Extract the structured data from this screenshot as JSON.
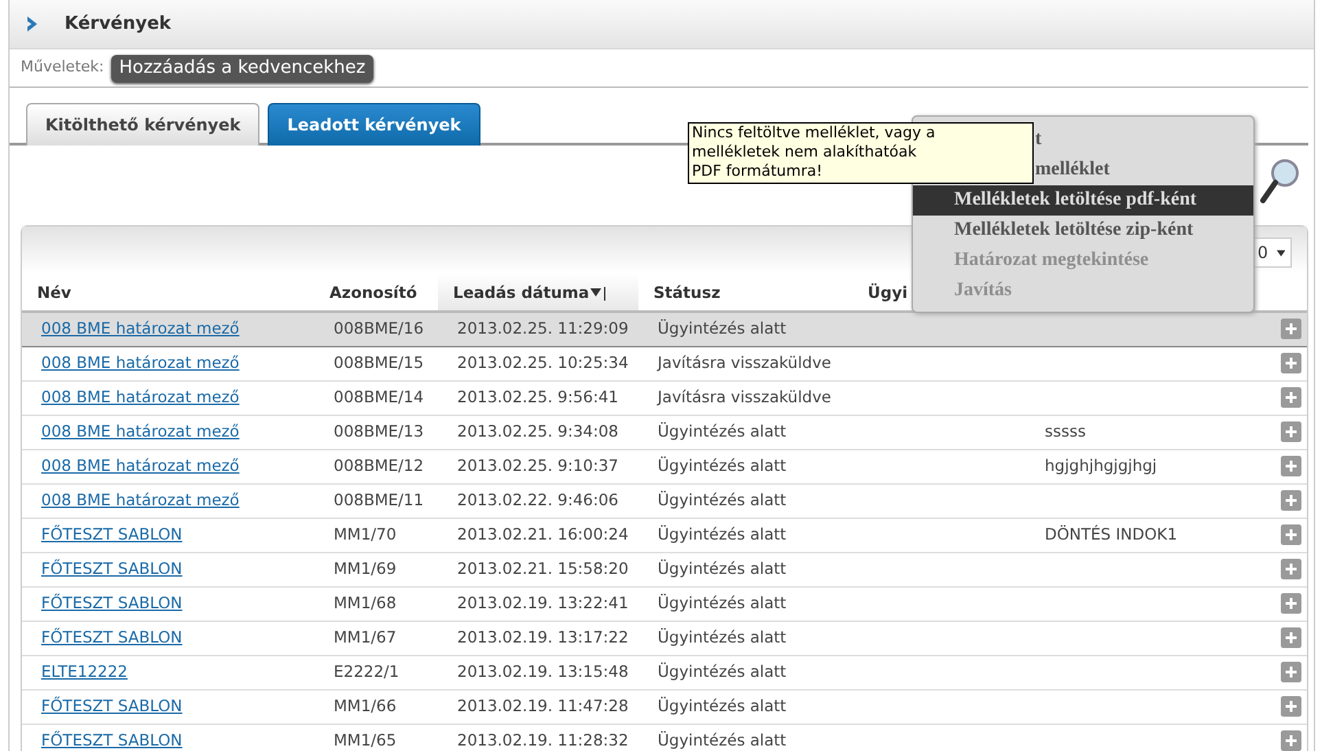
{
  "header": {
    "title": "Kérvények"
  },
  "actions": {
    "label": "Műveletek:",
    "buttons": [
      "Hozzáadás a kedvencekhez"
    ]
  },
  "tabs": [
    {
      "label": "Kitölthető kérvények",
      "selected": false
    },
    {
      "label": "Leadott kérvények",
      "selected": true
    }
  ],
  "page_size": {
    "value": "0"
  },
  "table": {
    "columns": [
      {
        "label": "Név",
        "sorted": false
      },
      {
        "label": "Azonosító",
        "sorted": false
      },
      {
        "label": "Leadás dátuma",
        "sorted": true
      },
      {
        "label": "Státusz",
        "sorted": false
      },
      {
        "label": "Ügyi",
        "sorted": false
      }
    ],
    "rows": [
      {
        "name": "008 BME határozat mező",
        "id": "008BME/16",
        "date": "2013.02.25. 11:29:09",
        "status": "Ügyintézés alatt",
        "selected": true
      },
      {
        "name": "008 BME határozat mező",
        "id": "008BME/15",
        "date": "2013.02.25. 10:25:34",
        "status": "Javításra visszaküldve",
        "selected": false
      },
      {
        "name": "008 BME határozat mező",
        "id": "008BME/14",
        "date": "2013.02.25. 9:56:41",
        "status": "Javításra visszaküldve",
        "selected": false
      },
      {
        "name": "008 BME határozat mező",
        "id": "008BME/13",
        "date": "2013.02.25. 9:34:08",
        "status": "Ügyintézés alatt",
        "column_6": "sssss",
        "selected": false
      },
      {
        "name": "008 BME határozat mező",
        "id": "008BME/12",
        "date": "2013.02.25. 9:10:37",
        "status": "Ügyintézés alatt",
        "column_6": "hgjghjhgjgjhgj",
        "selected": false
      },
      {
        "name": "008 BME határozat mező",
        "id": "008BME/11",
        "date": "2013.02.22. 9:46:06",
        "status": "Ügyintézés alatt",
        "selected": false
      },
      {
        "name": "FŐTESZT SABLON",
        "id": "MM1/70",
        "date": "2013.02.21. 16:00:24",
        "status": "Ügyintézés alatt",
        "column_6": "DÖNTÉS INDOK1",
        "selected": false
      },
      {
        "name": "FŐTESZT SABLON",
        "id": "MM1/69",
        "date": "2013.02.21. 15:58:20",
        "status": "Ügyintézés alatt",
        "selected": false
      },
      {
        "name": "FŐTESZT SABLON",
        "id": "MM1/68",
        "date": "2013.02.19. 13:22:41",
        "status": "Ügyintézés alatt",
        "selected": false
      },
      {
        "name": "FŐTESZT SABLON",
        "id": "MM1/67",
        "date": "2013.02.19. 13:17:22",
        "status": "Ügyintézés alatt",
        "selected": false
      },
      {
        "name": "ELTE12222",
        "id": "E2222/1",
        "date": "2013.02.19. 13:15:48",
        "status": "Ügyintézés alatt",
        "selected": false
      },
      {
        "name": "FŐTESZT SABLON",
        "id": "MM1/66",
        "date": "2013.02.19. 11:47:28",
        "status": "Ügyintézés alatt",
        "selected": false
      },
      {
        "name": "FŐTESZT SABLON",
        "id": "MM1/65",
        "date": "2013.02.19. 11:28:32",
        "status": "Ügyintézés alatt",
        "selected": false
      }
    ]
  },
  "context_menu": {
    "items": [
      {
        "kind": "partial",
        "label": "t",
        "selected": false,
        "disabled": false
      },
      {
        "kind": "partial",
        "label": "melléklet",
        "selected": false,
        "disabled": false
      },
      {
        "kind": "full",
        "label": "Mellékletek letöltése pdf-ként",
        "selected": true,
        "disabled": false
      },
      {
        "kind": "full",
        "label": "Mellékletek letöltése zip-ként",
        "selected": false,
        "disabled": false
      },
      {
        "kind": "full",
        "label": "Határozat megtekintése",
        "selected": false,
        "disabled": true
      },
      {
        "kind": "full",
        "label": "Javítás",
        "selected": false,
        "disabled": true
      }
    ]
  },
  "tooltip": {
    "text": "Nincs feltöltve melléklet, vagy a mellékletek nem alakíthatóak PDF formátumra!"
  }
}
